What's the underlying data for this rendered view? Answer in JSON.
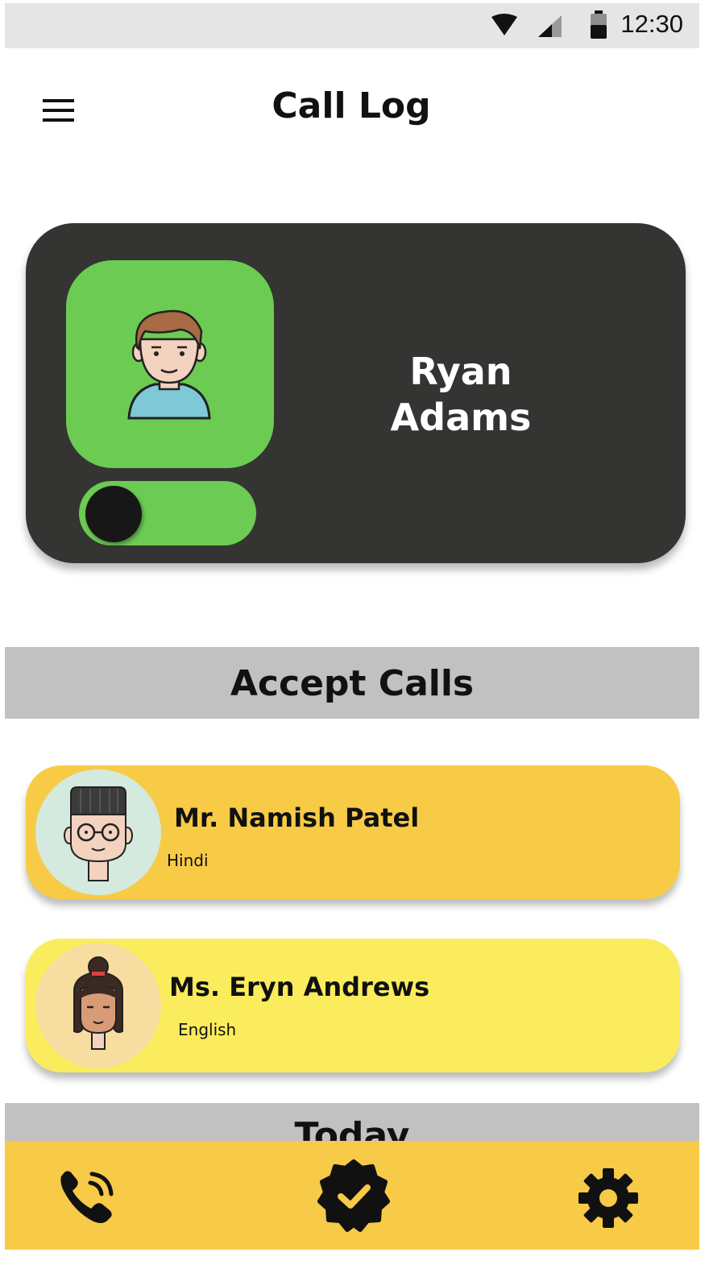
{
  "status_bar": {
    "time": "12:30",
    "icons": [
      "wifi-icon",
      "cell-signal-icon",
      "battery-icon"
    ]
  },
  "header": {
    "title": "Call Log",
    "menu_icon": "hamburger-menu-icon"
  },
  "profile": {
    "name_first": "Ryan",
    "name_last": "Adams",
    "avatar_icon": "male-avatar-icon",
    "toggle_on": true
  },
  "sections": {
    "accept_calls": "Accept Calls",
    "today": "Today"
  },
  "callers": [
    {
      "name": "Mr. Namish Patel",
      "language": "Hindi",
      "avatar_icon": "man-with-glasses-avatar-icon"
    },
    {
      "name": "Ms. Eryn Andrews",
      "language": "English",
      "avatar_icon": "woman-avatar-icon"
    }
  ],
  "bottom_nav": {
    "items": [
      "phone-call-icon",
      "verified-badge-icon",
      "settings-gear-icon"
    ]
  },
  "colors": {
    "card_dark": "#343532",
    "accent_green": "#6ccb52",
    "card_orange": "#f8cb46",
    "card_yellow": "#fbec5d",
    "nav_yellow": "#f7ca47",
    "section_gray": "#c1c1c1"
  }
}
